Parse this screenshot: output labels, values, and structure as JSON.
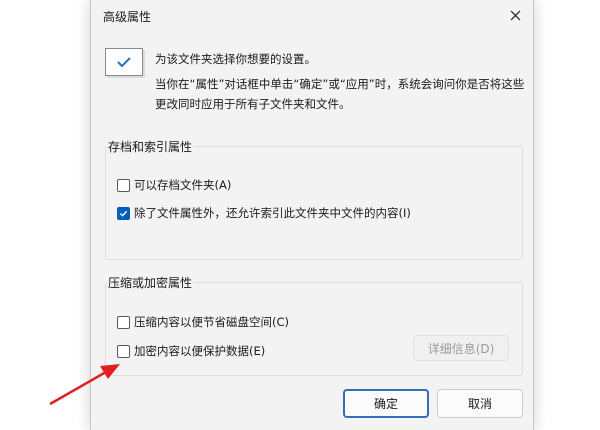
{
  "dialog": {
    "title": "高级属性",
    "intro_line1": "为该文件夹选择你想要的设置。",
    "intro_line2": "当你在“属性”对话框中单击“确定”或“应用”时，系统会询问你是否将这些更改同时应用于所有子文件夹和文件。"
  },
  "archive_group": {
    "legend": "存档和索引属性",
    "archive": {
      "label": "可以存档文件夹(A)",
      "checked": false
    },
    "index": {
      "label": "除了文件属性外，还允许索引此文件夹中文件的内容(I)",
      "checked": true
    }
  },
  "compress_group": {
    "legend": "压缩或加密属性",
    "compress": {
      "label": "压缩内容以便节省磁盘空间(C)",
      "checked": false
    },
    "encrypt": {
      "label": "加密内容以便保护数据(E)",
      "checked": false
    },
    "details_label": "详细信息(D)"
  },
  "buttons": {
    "ok": "确定",
    "cancel": "取消"
  },
  "colors": {
    "accent": "#005fb8",
    "annotation_arrow": "#e02020"
  }
}
